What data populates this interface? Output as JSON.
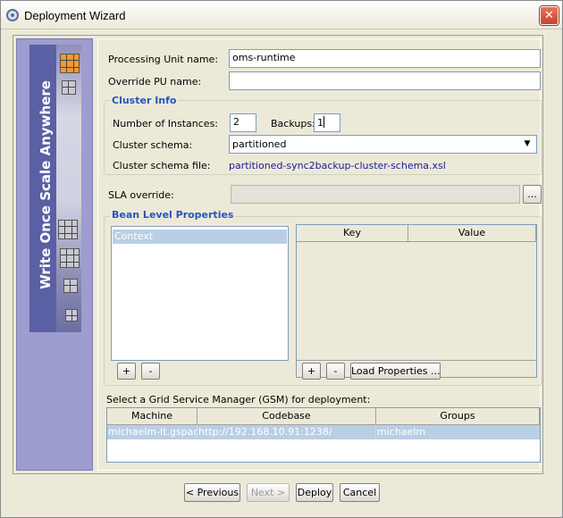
{
  "window": {
    "title": "Deployment Wizard",
    "close_glyph": "✕"
  },
  "banner": {
    "text": "Write Once Scale Anywhere"
  },
  "form": {
    "pu_name_label": "Processing Unit name:",
    "pu_name_value": "oms-runtime",
    "override_label": "Override PU name:",
    "override_value": ""
  },
  "cluster_info": {
    "title": "Cluster Info",
    "instances_label": "Number of Instances:",
    "instances_value": "2",
    "backups_label": "Backups:",
    "backups_value": "1",
    "schema_label": "Cluster schema:",
    "schema_value": "partitioned",
    "schema_file_label": "Cluster schema file:",
    "schema_file_value": "partitioned-sync2backup-cluster-schema.xsl"
  },
  "sla": {
    "label": "SLA override:",
    "value": "",
    "browse_label": "..."
  },
  "bean_props": {
    "title": "Bean Level Properties",
    "contexts": [
      "Context"
    ],
    "add_label": "+",
    "remove_label": "-",
    "key_header": "Key",
    "value_header": "Value",
    "load_label": "Load Properties ..."
  },
  "gsm": {
    "prompt": "Select a Grid Service Manager (GSM) for deployment:",
    "columns": [
      "Machine",
      "Codebase",
      "Groups"
    ],
    "rows": [
      {
        "machine": "michaelm-lt.gspac...",
        "codebase": "http://192.168.10.91:1238/",
        "groups": "michaelm"
      }
    ]
  },
  "footer": {
    "previous_label": "< Previous",
    "next_label": "Next >",
    "deploy_label": "Deploy",
    "cancel_label": "Cancel"
  },
  "colors": {
    "group_title": "#2555c0",
    "banner_bg": "#5b5fa4",
    "selection": "#b8cfe5"
  },
  "icons": {
    "app": "gigaspaces-logo-icon",
    "close": "close-icon",
    "combo_arrow": "chevron-down-icon"
  }
}
